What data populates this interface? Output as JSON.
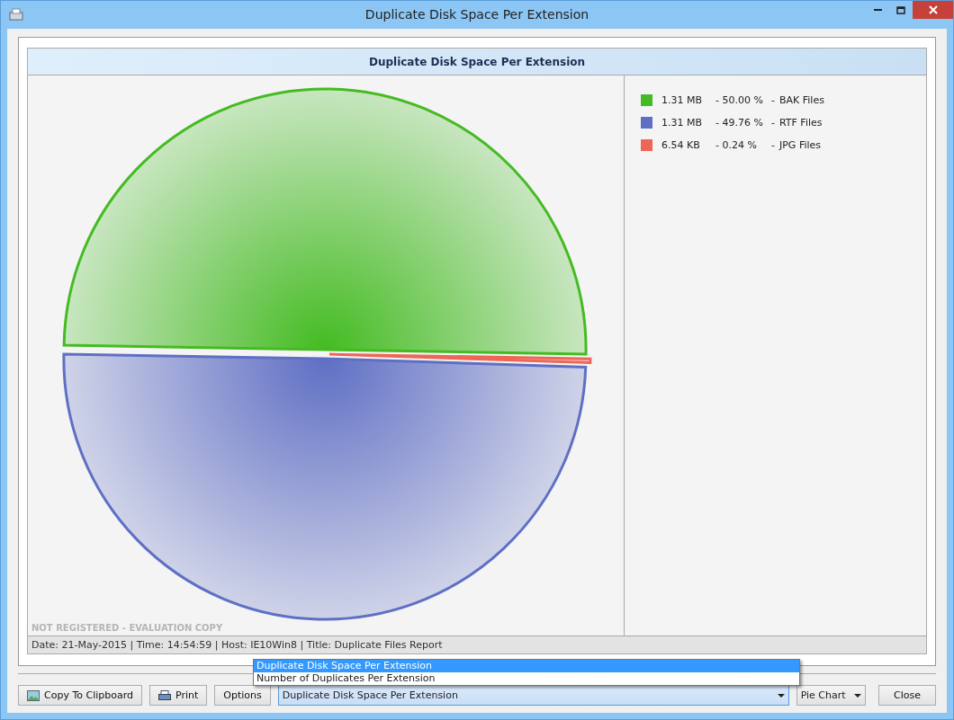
{
  "window": {
    "title": "Duplicate Disk Space Per Extension"
  },
  "chart_panel": {
    "title": "Duplicate Disk Space Per Extension",
    "chart_data": {
      "type": "pie",
      "categories": [
        "BAK Files",
        "RTF Files",
        "JPG Files"
      ],
      "values": [
        50.0,
        49.76,
        0.24
      ]
    },
    "legend": [
      {
        "color": "#44bb22",
        "size": "1.31 MB",
        "percent": "- 50.00 %",
        "dash": "-"
      },
      {
        "color": "#5f6fc4",
        "size": "1.31 MB",
        "percent": "- 49.76 %",
        "dash": "-"
      },
      {
        "color": "#ee6655",
        "size": "6.54 KB",
        "percent": "- 0.24 %",
        "dash": "-"
      }
    ],
    "notice": "NOT REGISTERED - EVALUATION COPY",
    "footer": "Date: 21-May-2015 | Time: 14:54:59 | Host: IE10Win8 | Title: Duplicate Files Report"
  },
  "buttons": {
    "copy": "Copy To Clipboard",
    "print": "Print",
    "options": "Options",
    "close": "Close"
  },
  "report_select": {
    "value": "Duplicate Disk Space Per Extension",
    "options": [
      {
        "label": "Duplicate Disk Space Per Extension",
        "selected": true
      },
      {
        "label": "Number of Duplicates Per Extension",
        "selected": false
      }
    ]
  },
  "chart_type_select": {
    "value": "Pie Chart"
  }
}
